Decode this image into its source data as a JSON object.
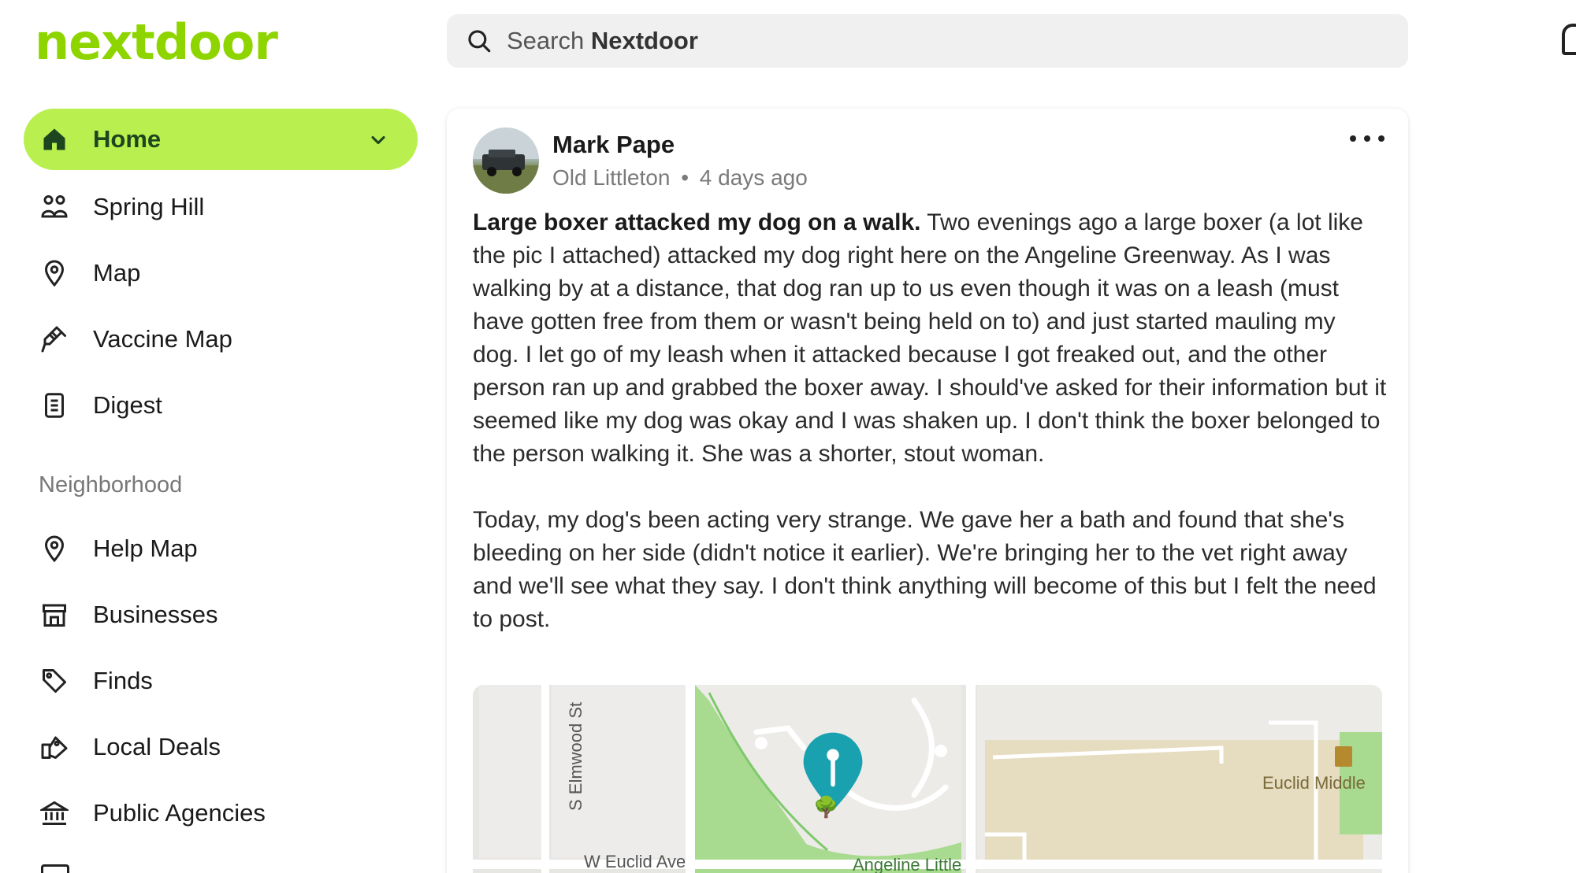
{
  "app": {
    "logo": "nextdoor"
  },
  "search": {
    "prefix": "Search ",
    "brand": "Nextdoor"
  },
  "sidebar": {
    "items": [
      {
        "label": "Home",
        "icon": "home-icon",
        "active": true
      },
      {
        "label": "Spring Hill",
        "icon": "neighbors-icon"
      },
      {
        "label": "Map",
        "icon": "map-pin-icon"
      },
      {
        "label": "Vaccine Map",
        "icon": "syringe-icon"
      },
      {
        "label": "Digest",
        "icon": "digest-icon"
      }
    ],
    "section_title": "Neighborhood",
    "section_items": [
      {
        "label": "Help Map",
        "icon": "map-pin-icon"
      },
      {
        "label": "Businesses",
        "icon": "storefront-icon"
      },
      {
        "label": "Finds",
        "icon": "tag-icon"
      },
      {
        "label": "Local Deals",
        "icon": "deals-icon"
      },
      {
        "label": "Public Agencies",
        "icon": "government-icon"
      }
    ]
  },
  "post": {
    "author": "Mark Pape",
    "location": "Old Littleton",
    "separator": "•",
    "time": "4 days ago",
    "title": "Large boxer attacked my dog on a walk.",
    "paragraph1": " Two evenings ago a large boxer (a lot like the pic I attached) attacked my dog right here on the Angeline Greenway. As I was walking by at a distance, that dog ran up to us even though it was on a leash (must have gotten free from them or wasn't being held on to) and just started mauling my dog. I let go of my leash when it attacked because I got freaked out, and the other person ran up and grabbed the boxer away. I should've asked for their information but it seemed like my dog was okay and I was shaken up. I don't think the boxer belonged to the person walking it. She was a shorter, stout woman.",
    "paragraph2": "Today, my dog's been acting very strange. We gave her a bath and found that she's bleeding on her side (didn't notice it earlier). We're bringing her to the vet right away and we'll see what they say. I don't think anything will become of this but I felt the need to post."
  },
  "map": {
    "labels": {
      "street1": "S Elmwood St",
      "street2": "W Euclid Ave",
      "place1": "Euclid Middle",
      "place2": "Angeline Little"
    },
    "colors": {
      "park": "#a8db8f",
      "school": "#e6dcc0",
      "pin": "#1aa1b0"
    }
  },
  "colors": {
    "brand": "#8ed500",
    "active_nav": "#b9ef4e",
    "active_text": "#1d4620"
  }
}
